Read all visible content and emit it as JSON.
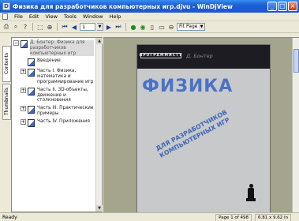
{
  "window": {
    "title": "Физика для разработчиков компьютерных игр.djvu - WinDjView",
    "app_icon": "D"
  },
  "menu": {
    "items": [
      "File",
      "Edit",
      "View",
      "Tools",
      "Window",
      "Help"
    ]
  },
  "toolbar": {
    "page_value": "1",
    "zoom_value": "Fit Page",
    "icons": [
      "print-icon",
      "find-icon",
      "help-icon",
      "select-icon",
      "zoom-icon",
      "first-page-icon",
      "prev-page-icon",
      "next-page-icon",
      "last-page-icon",
      "rotate-icon",
      "continuous-icon",
      "layout-icon",
      "zoom-out-icon",
      "zoom-in-icon"
    ]
  },
  "sidebar": {
    "tabs": [
      "Contents",
      "Thumbnails"
    ],
    "tree": [
      {
        "label": "Д. Бонтер. Физика для разработчиков компьютерных игр",
        "expander": "−",
        "level": 0
      },
      {
        "label": "Введение",
        "level": 1
      },
      {
        "label": "Часть I. Физика, математика и программирование игр",
        "expander": "+",
        "level": 1
      },
      {
        "label": "Часть II. 3D-объекты, движение и столкновения",
        "expander": "+",
        "level": 1
      },
      {
        "label": "Часть III. Практические примеры",
        "expander": "+",
        "level": 1
      },
      {
        "label": "Часть IV. Приложения",
        "expander": "+",
        "level": 1
      }
    ]
  },
  "document": {
    "series": "ПРОГРАММИСТУ",
    "author": "Д. Бонтер",
    "title": "ФИЗИКА",
    "subtitle_line1": "ДЛЯ РАЗРАБОТЧИКОВ",
    "subtitle_line2": "КОМПЬЮТЕРНЫХ ИГР"
  },
  "status": {
    "left": "Ready",
    "page": "Page 1 of 498",
    "size": "6.81 x 9.62 in"
  },
  "colors": {
    "titlebar": "#1b5fd6",
    "title_blue": "#4b72c8",
    "cover_bg": "#c8c9cb",
    "view_bg": "#a5a48d"
  }
}
